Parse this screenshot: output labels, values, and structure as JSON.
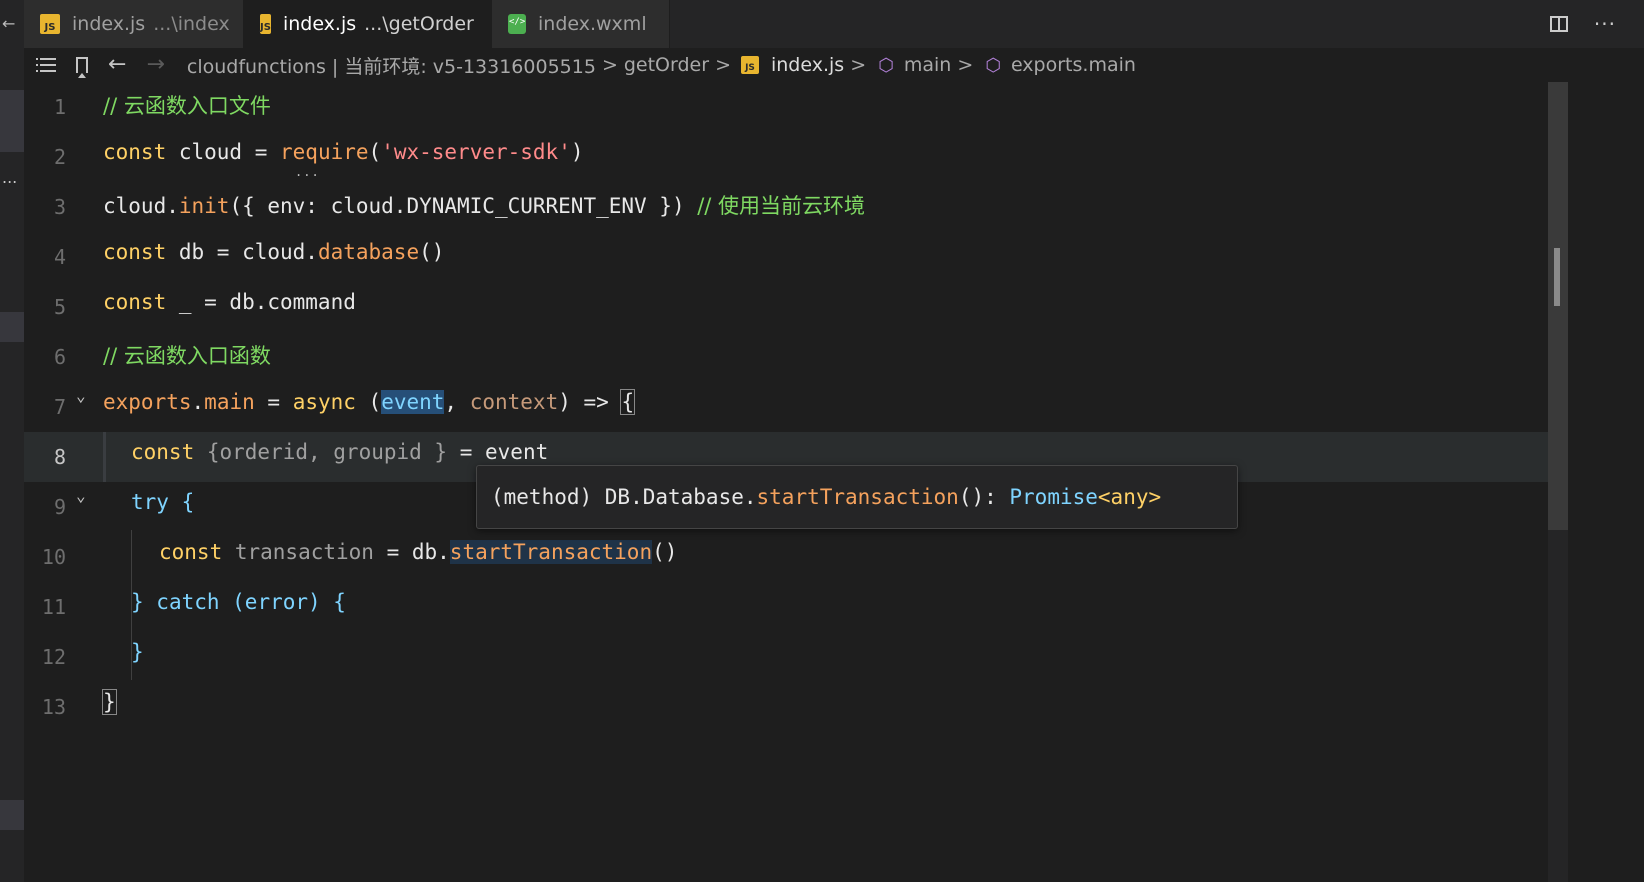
{
  "tabs": [
    {
      "name": "index.js",
      "path": "...\\index",
      "icon": "js-file-icon"
    },
    {
      "name": "index.js",
      "path": "...\\getOrder",
      "icon": "js-file-icon",
      "active": true,
      "dirty": true
    },
    {
      "name": "index.wxml",
      "path": "",
      "icon": "wxml-file-icon"
    }
  ],
  "tab_actions": {
    "split": "split-editor-icon",
    "more": "···"
  },
  "breadcrumb": {
    "root": "cloudfunctions | 当前环境: v5-13316005515",
    "folder": "getOrder",
    "file": "index.js",
    "symbol1": "main",
    "symbol2": "exports.main",
    "sep": ">"
  },
  "left_strip": {
    "back": "←",
    "ellipsis": "..."
  },
  "lines": {
    "1": {
      "cmt": "// 云函数入口文件"
    },
    "2": {
      "kw": "const",
      "a": " cloud = ",
      "fn": "require",
      "b": "(",
      "str": "'wx-server-sdk'",
      "c": ")"
    },
    "3": {
      "a": "cloud.",
      "fn": "init",
      "b": "({ env: cloud.DYNAMIC_CURRENT_ENV }) ",
      "cmt": "// 使用当前云环境"
    },
    "4": {
      "kw": "const",
      "a": " db = cloud.",
      "fn": "database",
      "b": "()"
    },
    "5": {
      "kw": "const",
      "a": " _ = db.command"
    },
    "6": {
      "cmt": "// 云函数入口函数"
    },
    "7": {
      "fn1": "exports",
      "a": ".",
      "fn2": "main",
      "b": " = ",
      "kw": "async",
      "c": " (",
      "p1": "event",
      "d": ", ",
      "p2": "context",
      "e": ") => ",
      "brace": "{"
    },
    "8": {
      "kw": "const",
      "a": " {orderid, groupid } ",
      "b": "= event"
    },
    "9": {
      "kw": "try",
      "a": " {"
    },
    "10": {
      "kw": "const",
      "a": " transaction",
      "b": " = db.",
      "fn": "startTransaction",
      "c": "()"
    },
    "11": {
      "a": "} ",
      "kw": "catch",
      "b": " (error) {"
    },
    "12": {
      "a": "}"
    },
    "13": {
      "brace": "}"
    }
  },
  "line_numbers": [
    "1",
    "2",
    "3",
    "4",
    "5",
    "6",
    "7",
    "8",
    "9",
    "10",
    "11",
    "12",
    "13"
  ],
  "tooltip": {
    "pre": "(method) DB.Database.",
    "method": "startTransaction",
    "mid": "(): ",
    "type": "Promise",
    "generic": "<any>"
  },
  "hint_dots": "..."
}
